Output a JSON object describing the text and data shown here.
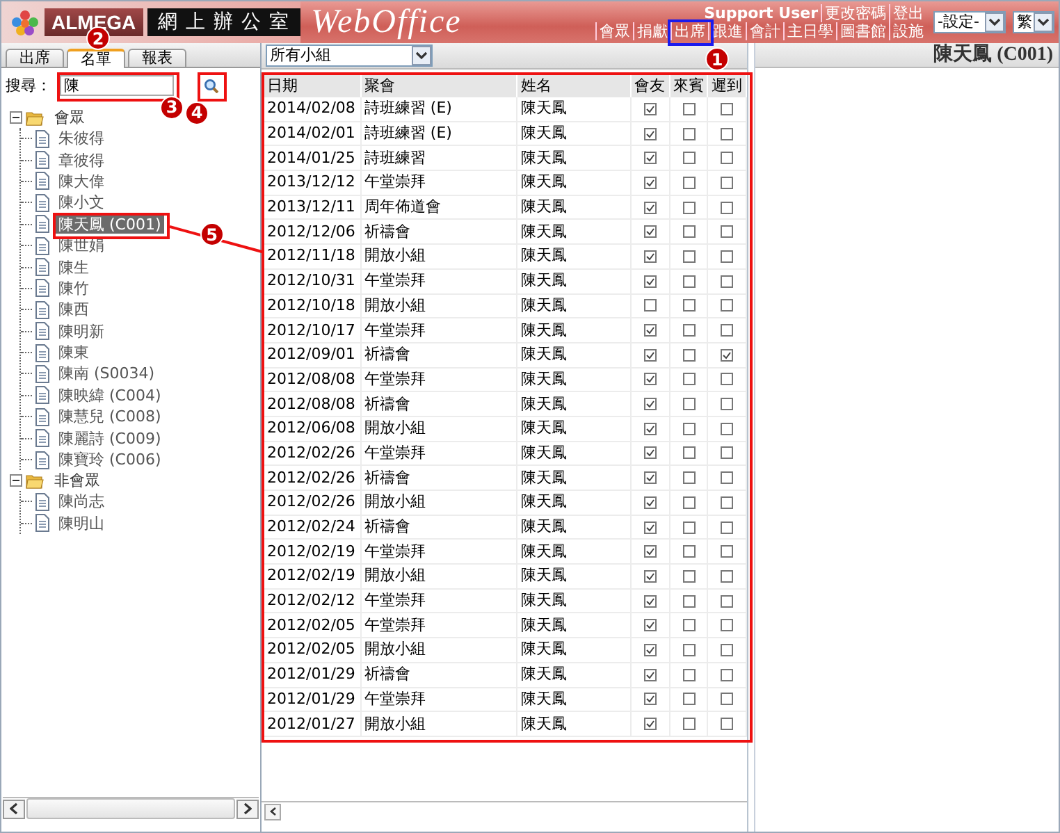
{
  "header": {
    "logo_text": "ALMEGA",
    "title": "網上辦公室",
    "brand": "WebOffice",
    "user_links": [
      "Support User",
      "更改密碼",
      "登出"
    ],
    "nav": [
      "會眾",
      "捐獻",
      "出席",
      "跟進",
      "會計",
      "主日學",
      "圖書館",
      "設施"
    ],
    "settings_select": "-設定-",
    "language_select": "繁"
  },
  "sidebar": {
    "tabs": [
      {
        "label": "出席",
        "selected": false
      },
      {
        "label": "名單",
        "selected": true
      },
      {
        "label": "報表",
        "selected": false
      }
    ],
    "search": {
      "label": "搜尋：",
      "value": "陳"
    },
    "tree": [
      {
        "label": "會眾",
        "expanded": true,
        "children": [
          {
            "label": "朱彼得",
            "selected": false
          },
          {
            "label": "章彼得",
            "selected": false
          },
          {
            "label": "陳大偉",
            "selected": false
          },
          {
            "label": "陳小文",
            "selected": false
          },
          {
            "label": "陳天鳳 (C001)",
            "selected": true
          },
          {
            "label": "陳世娟",
            "selected": false
          },
          {
            "label": "陳生",
            "selected": false
          },
          {
            "label": "陳竹",
            "selected": false
          },
          {
            "label": "陳西",
            "selected": false
          },
          {
            "label": "陳明新",
            "selected": false
          },
          {
            "label": "陳東",
            "selected": false
          },
          {
            "label": "陳南 (S0034)",
            "selected": false
          },
          {
            "label": "陳映緯 (C004)",
            "selected": false
          },
          {
            "label": "陳慧兒 (C008)",
            "selected": false
          },
          {
            "label": "陳麗詩 (C009)",
            "selected": false
          },
          {
            "label": "陳寶玲 (C006)",
            "selected": false
          }
        ]
      },
      {
        "label": "非會眾",
        "expanded": true,
        "children": [
          {
            "label": "陳尚志",
            "selected": false
          },
          {
            "label": "陳明山",
            "selected": false
          }
        ]
      }
    ]
  },
  "attendance": {
    "group_select": "所有小組",
    "columns": [
      "日期",
      "聚會",
      "姓名",
      "會友",
      "來賓",
      "遲到"
    ],
    "rows": [
      {
        "date": "2014/02/08",
        "meeting": "詩班練習 (E)",
        "name": "陳天鳳",
        "member": true,
        "guest": false,
        "late": false
      },
      {
        "date": "2014/02/01",
        "meeting": "詩班練習 (E)",
        "name": "陳天鳳",
        "member": true,
        "guest": false,
        "late": false
      },
      {
        "date": "2014/01/25",
        "meeting": "詩班練習",
        "name": "陳天鳳",
        "member": true,
        "guest": false,
        "late": false
      },
      {
        "date": "2013/12/12",
        "meeting": "午堂崇拜",
        "name": "陳天鳳",
        "member": true,
        "guest": false,
        "late": false
      },
      {
        "date": "2013/12/11",
        "meeting": "周年佈道會",
        "name": "陳天鳳",
        "member": true,
        "guest": false,
        "late": false
      },
      {
        "date": "2012/12/06",
        "meeting": "祈禱會",
        "name": "陳天鳳",
        "member": true,
        "guest": false,
        "late": false
      },
      {
        "date": "2012/11/18",
        "meeting": "開放小組",
        "name": "陳天鳳",
        "member": true,
        "guest": false,
        "late": false
      },
      {
        "date": "2012/10/31",
        "meeting": "午堂崇拜",
        "name": "陳天鳳",
        "member": true,
        "guest": false,
        "late": false
      },
      {
        "date": "2012/10/18",
        "meeting": "開放小組",
        "name": "陳天鳳",
        "member": false,
        "guest": false,
        "late": false
      },
      {
        "date": "2012/10/17",
        "meeting": "午堂崇拜",
        "name": "陳天鳳",
        "member": true,
        "guest": false,
        "late": false
      },
      {
        "date": "2012/09/01",
        "meeting": "祈禱會",
        "name": "陳天鳳",
        "member": true,
        "guest": false,
        "late": true
      },
      {
        "date": "2012/08/08",
        "meeting": "午堂崇拜",
        "name": "陳天鳳",
        "member": true,
        "guest": false,
        "late": false
      },
      {
        "date": "2012/08/08",
        "meeting": "祈禱會",
        "name": "陳天鳳",
        "member": true,
        "guest": false,
        "late": false
      },
      {
        "date": "2012/06/08",
        "meeting": "開放小組",
        "name": "陳天鳳",
        "member": true,
        "guest": false,
        "late": false
      },
      {
        "date": "2012/02/26",
        "meeting": "午堂崇拜",
        "name": "陳天鳳",
        "member": true,
        "guest": false,
        "late": false
      },
      {
        "date": "2012/02/26",
        "meeting": "祈禱會",
        "name": "陳天鳳",
        "member": true,
        "guest": false,
        "late": false
      },
      {
        "date": "2012/02/26",
        "meeting": "開放小組",
        "name": "陳天鳳",
        "member": true,
        "guest": false,
        "late": false
      },
      {
        "date": "2012/02/24",
        "meeting": "祈禱會",
        "name": "陳天鳳",
        "member": true,
        "guest": false,
        "late": false
      },
      {
        "date": "2012/02/19",
        "meeting": "午堂崇拜",
        "name": "陳天鳳",
        "member": true,
        "guest": false,
        "late": false
      },
      {
        "date": "2012/02/19",
        "meeting": "開放小組",
        "name": "陳天鳳",
        "member": true,
        "guest": false,
        "late": false
      },
      {
        "date": "2012/02/12",
        "meeting": "午堂崇拜",
        "name": "陳天鳳",
        "member": true,
        "guest": false,
        "late": false
      },
      {
        "date": "2012/02/05",
        "meeting": "午堂崇拜",
        "name": "陳天鳳",
        "member": true,
        "guest": false,
        "late": false
      },
      {
        "date": "2012/02/05",
        "meeting": "開放小組",
        "name": "陳天鳳",
        "member": true,
        "guest": false,
        "late": false
      },
      {
        "date": "2012/01/29",
        "meeting": "祈禱會",
        "name": "陳天鳳",
        "member": true,
        "guest": false,
        "late": false
      },
      {
        "date": "2012/01/29",
        "meeting": "午堂崇拜",
        "name": "陳天鳳",
        "member": true,
        "guest": false,
        "late": false
      },
      {
        "date": "2012/01/27",
        "meeting": "開放小組",
        "name": "陳天鳳",
        "member": true,
        "guest": false,
        "late": false
      }
    ]
  },
  "detail": {
    "title": "陳天鳳 (C001)"
  },
  "highlights": [
    {
      "color": "#1a1aee"
    },
    {
      "color": "#ee1111"
    },
    {
      "color": "#ee1111"
    },
    {
      "color": "#ee1111"
    },
    {
      "color": "#ee1111"
    }
  ],
  "callouts": [
    "1",
    "2",
    "3",
    "4",
    "5"
  ]
}
